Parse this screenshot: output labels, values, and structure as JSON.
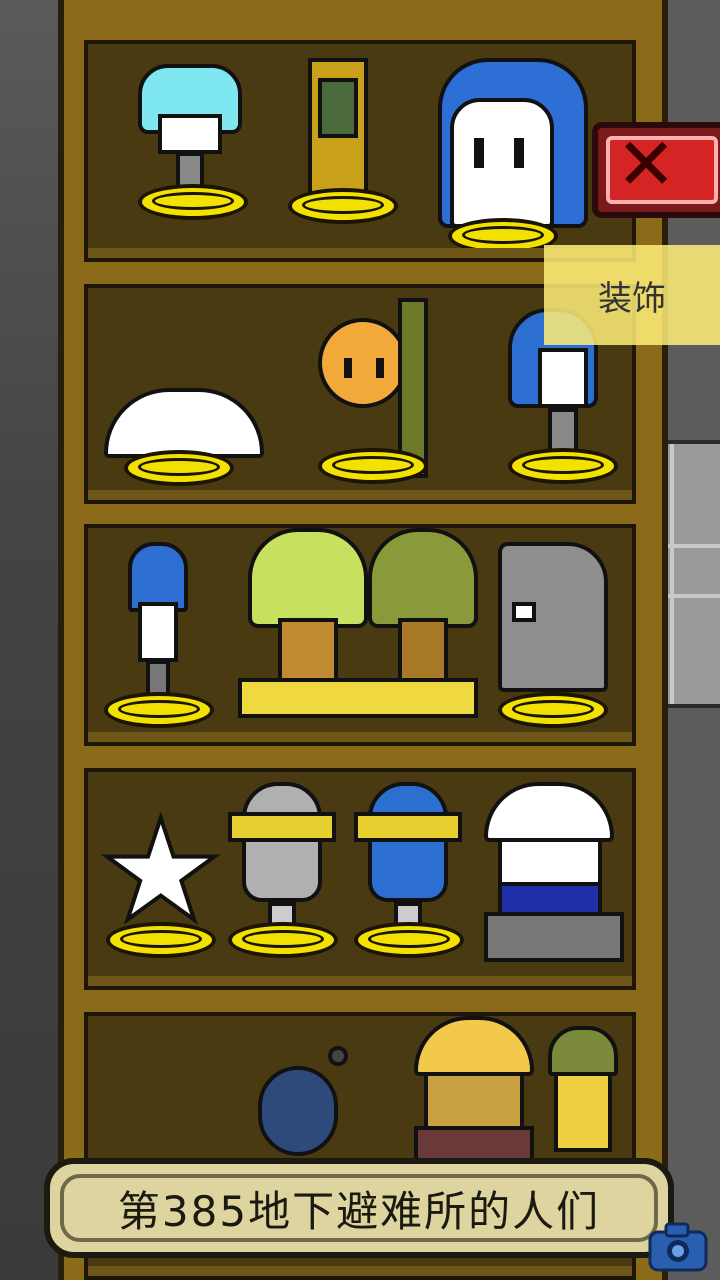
{
  "close_button": {
    "icon": "close-x-icon",
    "color": "#d42424"
  },
  "category_tab": {
    "label": "装饰"
  },
  "shelter_title": {
    "text": "第385地下避难所的人们"
  },
  "camera_button": {
    "icon": "camera-icon"
  },
  "shelves": [
    {
      "items": [
        "cyan-hair-figure-trophy",
        "framed-card-trophy",
        "bread-ghost-trophy"
      ]
    },
    {
      "items": [
        "hardhat-trophy",
        "orange-robot-trophy",
        "blue-hair-girl-trophy"
      ]
    },
    {
      "items": [
        "blue-hair-boy-trophy",
        "twin-plant-figures-trophy",
        "gray-rat-trophy"
      ]
    },
    {
      "items": [
        "white-star-trophy",
        "gray-robot-trophy",
        "blue-robot-trophy",
        "hardhat-worker-trophy"
      ]
    },
    {
      "items": [
        "blue-bomb-trophy",
        "yellow-hardhat-miner-trophy",
        "plant-kid-trophy"
      ]
    }
  ]
}
